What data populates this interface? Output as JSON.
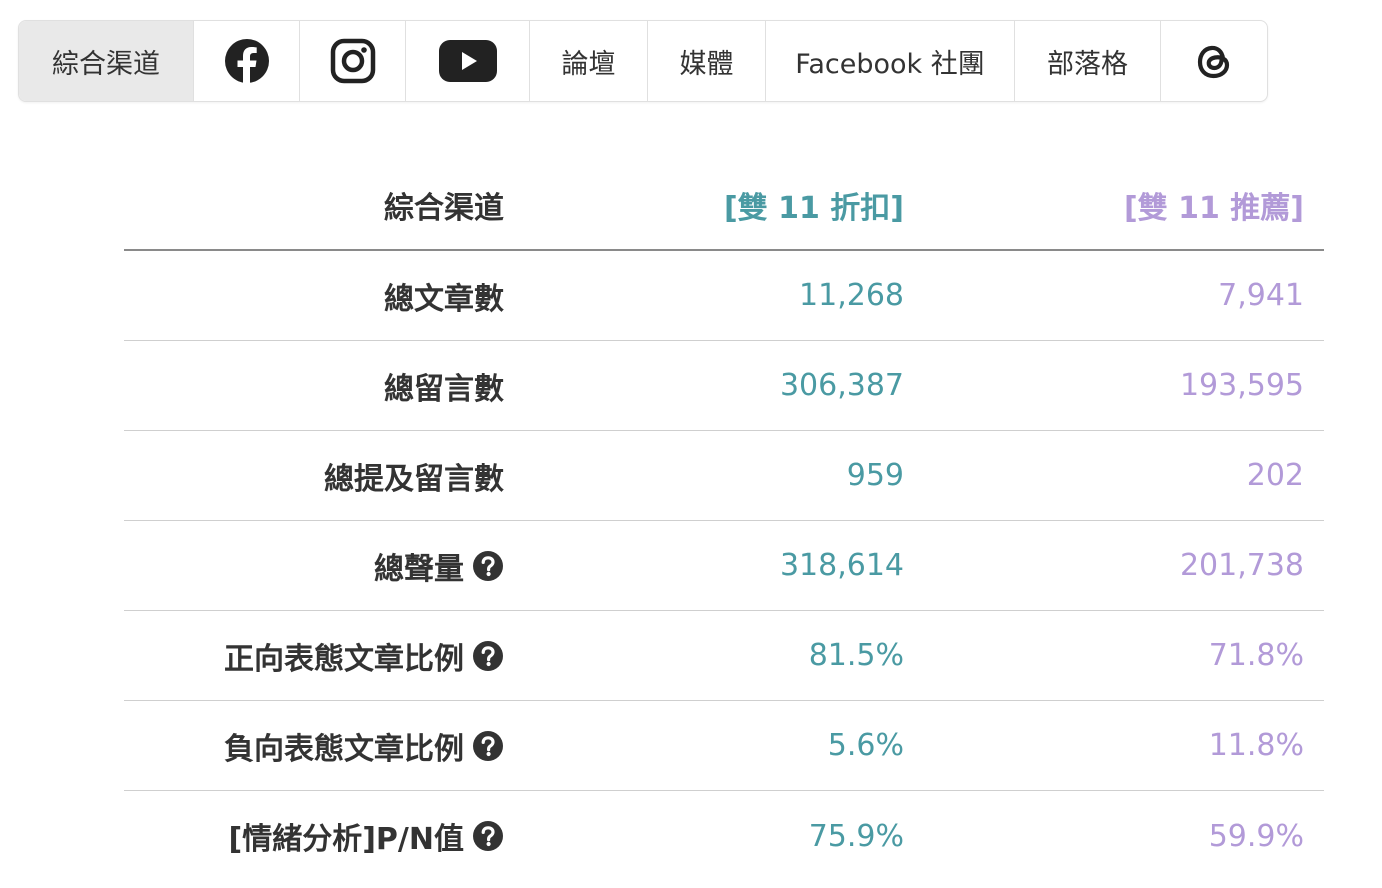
{
  "colors": {
    "series_a": "#4a9aa3",
    "series_b": "#b29ad8",
    "label_text": "#333333",
    "active_tab_bg": "#e9e9e9"
  },
  "tabs": [
    {
      "label": "綜合渠道",
      "active": true
    },
    {
      "icon": "facebook-icon"
    },
    {
      "icon": "instagram-icon"
    },
    {
      "icon": "youtube-icon"
    },
    {
      "label": "論壇"
    },
    {
      "label": "媒體"
    },
    {
      "label": "Facebook 社團"
    },
    {
      "label": "部落格"
    },
    {
      "icon": "threads-icon"
    }
  ],
  "table": {
    "header": {
      "label": "綜合渠道",
      "col_a": "[雙 11 折扣]",
      "col_b": "[雙 11 推薦]"
    },
    "rows": [
      {
        "label": "總文章數",
        "a": "11,268",
        "b": "7,941",
        "help": false
      },
      {
        "label": "總留言數",
        "a": "306,387",
        "b": "193,595",
        "help": false
      },
      {
        "label": "總提及留言數",
        "a": "959",
        "b": "202",
        "help": false
      },
      {
        "label": "總聲量",
        "a": "318,614",
        "b": "201,738",
        "help": true
      },
      {
        "label": "正向表態文章比例",
        "a": "81.5%",
        "b": "71.8%",
        "help": true
      },
      {
        "label": "負向表態文章比例",
        "a": "5.6%",
        "b": "11.8%",
        "help": true
      },
      {
        "label": "[情緒分析]P/N值",
        "a": "75.9%",
        "b": "59.9%",
        "help": true
      }
    ]
  }
}
